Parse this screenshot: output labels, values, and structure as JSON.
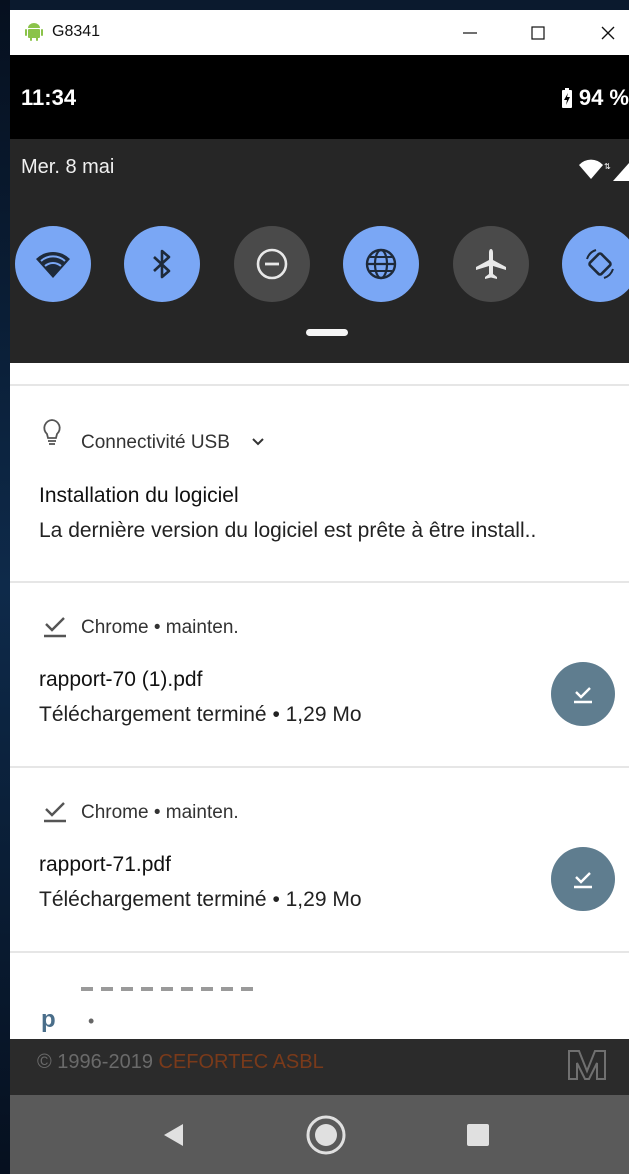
{
  "window": {
    "title": "G8341",
    "controls": [
      "minimize",
      "maximize",
      "close"
    ]
  },
  "statusbar": {
    "time": "11:34",
    "battery": "94 %"
  },
  "shade": {
    "date": "Mer. 8 mai",
    "tiles": [
      {
        "icon": "wifi-icon",
        "state": "on"
      },
      {
        "icon": "bluetooth-icon",
        "state": "on"
      },
      {
        "icon": "do-not-disturb-icon",
        "state": "off"
      },
      {
        "icon": "globe-icon",
        "state": "on"
      },
      {
        "icon": "airplane-icon",
        "state": "off"
      },
      {
        "icon": "auto-rotate-icon",
        "state": "on"
      }
    ]
  },
  "notifications": [
    {
      "app": "Connectivité USB",
      "title": "Installation du logiciel",
      "text": "La dernière version du logiciel est prête à être install.."
    },
    {
      "app": "Chrome • mainten.",
      "title": "rapport-70 (1).pdf",
      "text": "Téléchargement terminé • 1,29 Mo"
    },
    {
      "app": "Chrome • mainten.",
      "title": "rapport-71.pdf",
      "text": "Téléchargement terminé • 1,29 Mo"
    }
  ],
  "partial_notification": {
    "app_icon": "p",
    "dot": "•"
  },
  "footer": {
    "copyright": "© 1996-2019 ",
    "org": "CEFORTEC ASBL"
  },
  "colors": {
    "tile_on": "#7aa7f5",
    "tile_off": "#4a4a4a",
    "download_button": "#5f7d8f"
  }
}
